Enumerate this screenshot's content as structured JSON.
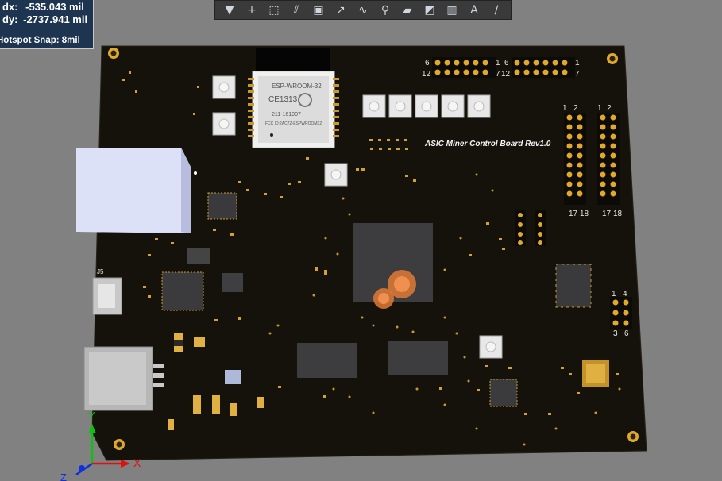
{
  "toolbar": {
    "tools": [
      {
        "name": "filter-tool",
        "glyph": "▼"
      },
      {
        "name": "route-tool",
        "glyph": "+"
      },
      {
        "name": "select-rect-tool",
        "glyph": "⬚"
      },
      {
        "name": "align-tool",
        "glyph": "⫽"
      },
      {
        "name": "component-tool",
        "glyph": "▣"
      },
      {
        "name": "track-tool",
        "glyph": "↗"
      },
      {
        "name": "diff-pair-tool",
        "glyph": "∿"
      },
      {
        "name": "via-tool",
        "glyph": "⚲"
      },
      {
        "name": "polygon-tool",
        "glyph": "▰"
      },
      {
        "name": "dimension-tool",
        "glyph": "◩"
      },
      {
        "name": "chart-tool",
        "glyph": "▥"
      },
      {
        "name": "text-tool",
        "glyph": "A"
      },
      {
        "name": "line-tool",
        "glyph": "/"
      }
    ]
  },
  "readout": {
    "dx_label": "dx:",
    "dx_value": "-535.043 mil",
    "dy_label": "dy:",
    "dy_value": "-2737.941 mil",
    "snap": "Hotspot Snap: 8mil"
  },
  "board": {
    "title": "ASIC Miner Control Board Rev1.0",
    "module_name": "ESP-WROOM-32",
    "module_ce": "CE1313",
    "module_code": "211-161007",
    "module_fcc": "FCC ID:2AC7Z-ESPWROOM32",
    "j5_label": "J5",
    "header_top_left": {
      "a": "6",
      "b": "12",
      "c": "1",
      "d": "7"
    },
    "header_top_right": {
      "a": "6",
      "b": "12",
      "c": "1",
      "d": "7"
    },
    "header_right_1": {
      "a": "2",
      "b": "1",
      "c": "18",
      "d": "17"
    },
    "header_right_2": {
      "a": "2",
      "b": "1",
      "c": "18",
      "d": "17"
    },
    "header_small": {
      "a": "4",
      "b": "1",
      "c": "6",
      "d": "3"
    }
  },
  "axes": {
    "x": "X",
    "y": "Y",
    "z": "Z"
  },
  "colors": {
    "board": "#13110c",
    "pad": "#e0a92a",
    "chip": "#3d3d3f",
    "usb_blue": "#d8dcf5",
    "metal": "#b9b9b9",
    "axis_x": "#e01010",
    "axis_y": "#10c010",
    "axis_z": "#1030e0"
  }
}
